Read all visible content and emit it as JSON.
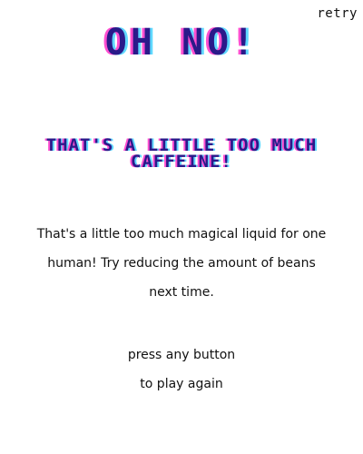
{
  "retry_label": "retry",
  "headline": "OH NO!",
  "subhead": "THAT'S A LITTLE TOO MUCH CAFFEINE!",
  "message": {
    "line1": "That's a little too much magical liquid for one",
    "line2": "human! Try reducing the amount of beans",
    "line3": "next time."
  },
  "prompt": {
    "line1": "press any button",
    "line2": "to play again"
  },
  "colors": {
    "title": "#2a1a8a",
    "glitch_pink": "#ff4fd0",
    "glitch_cyan": "#5fd8ff"
  }
}
